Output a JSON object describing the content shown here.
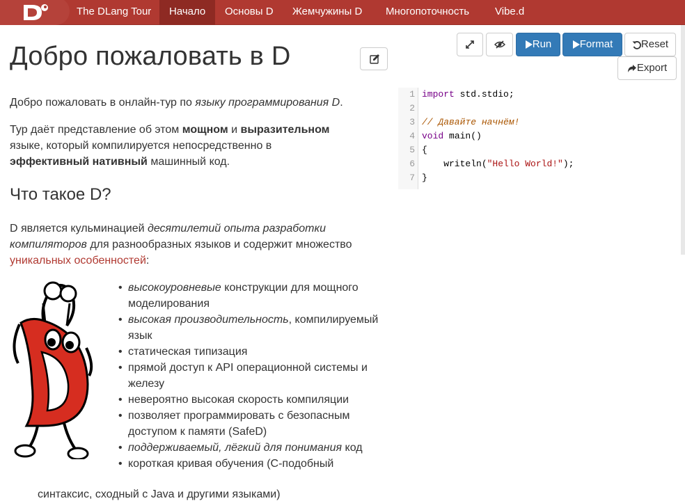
{
  "nav": {
    "brand": "The DLang Tour",
    "items": [
      {
        "label": "Начало",
        "active": true
      },
      {
        "label": "Основы D",
        "active": false
      },
      {
        "label": "Жемчужины D",
        "active": false
      },
      {
        "label": "Многопоточность",
        "active": false
      },
      {
        "label": "Vibe.d",
        "active": false
      }
    ]
  },
  "toolbar": {
    "run_label": "Run",
    "format_label": "Format",
    "reset_label": "Reset",
    "export_label": "Export"
  },
  "content": {
    "title": "Добро пожаловать в D",
    "intro_prefix": "Добро пожаловать в онлайн-тур по ",
    "intro_italic": "языку программирования D",
    "intro_suffix": ".",
    "p2_a": "Тур даёт представление об этом ",
    "p2_b": "мощном",
    "p2_c": " и ",
    "p2_d": "выразительном",
    "p2_e": "языке, который компилируется непосредственно в",
    "p2_f": "эффективный нативный",
    "p2_g": " машинный код.",
    "h2": "Что такое D?",
    "p3_a": "D является кульминацией ",
    "p3_b": "десятилетий опыта разработки",
    "p3_c": "компиляторов",
    "p3_d": " для разнообразных языков и содержит множество",
    "p3_link": "уникальных особенностей",
    "p3_e": ":",
    "features": [
      {
        "italic": "высокоуровневые",
        "text": " конструкции для мощного моделирования"
      },
      {
        "italic": "высокая производительность",
        "text": ", компилируемый язык"
      },
      {
        "italic": "",
        "text": "статическая типизация"
      },
      {
        "italic": "",
        "text": "прямой доступ к API операционной системы и железу"
      },
      {
        "italic": "",
        "text": "невероятно высокая скорость компиляции"
      },
      {
        "italic": "",
        "text": "позволяет программировать с безопасным доступом к памяти (SafeD)"
      },
      {
        "italic": "поддерживаемый, лёгкий для понимания",
        "text": " код"
      },
      {
        "italic": "",
        "text": "короткая кривая обучения (C-подобный"
      }
    ],
    "last_line": "синтаксис, сходный с Java и другими языками)"
  },
  "editor": {
    "line_numbers": [
      "1",
      "2",
      "3",
      "4",
      "5",
      "6",
      "7"
    ],
    "code": {
      "l1_kw": "import",
      "l1_rest": " std.stdio;",
      "l3_comment": "// Давайте начнём!",
      "l4_kw": "void",
      "l4_rest": " main()",
      "l5": "{",
      "l6_a": "    writeln(",
      "l6_str": "\"Hello World!\"",
      "l6_b": ");",
      "l7": "}"
    }
  },
  "icons": {
    "expand": "expand-icon",
    "eye": "eye-slash-icon",
    "edit": "edit-icon",
    "play": "play-icon",
    "reset": "undo-icon",
    "export": "share-icon"
  },
  "colors": {
    "navbar": "#b03931",
    "navbar_active": "#8e2a23",
    "primary": "#337ab7",
    "link": "#b03931"
  }
}
